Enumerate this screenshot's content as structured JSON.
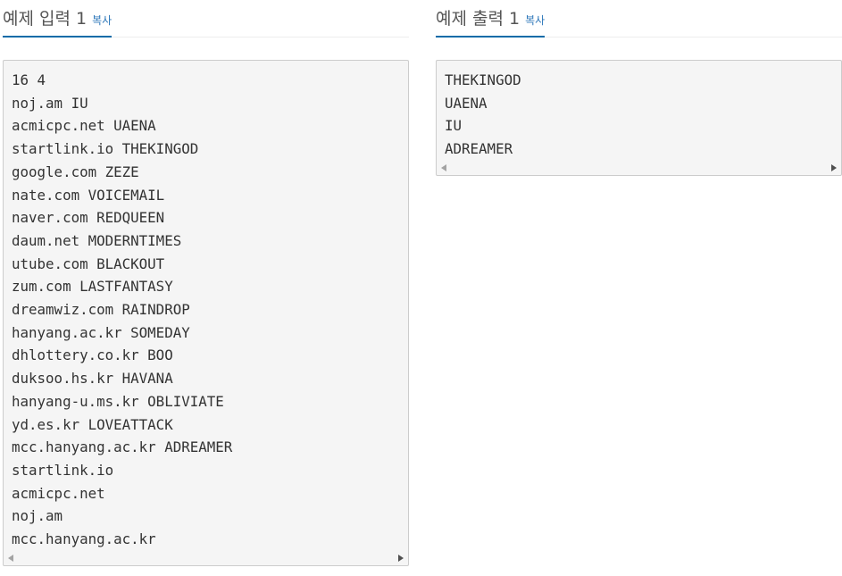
{
  "sample_input": {
    "title": "예제 입력 1",
    "copy_label": "복사",
    "lines": [
      "16 4",
      "noj.am IU",
      "acmicpc.net UAENA",
      "startlink.io THEKINGOD",
      "google.com ZEZE",
      "nate.com VOICEMAIL",
      "naver.com REDQUEEN",
      "daum.net MODERNTIMES",
      "utube.com BLACKOUT",
      "zum.com LASTFANTASY",
      "dreamwiz.com RAINDROP",
      "hanyang.ac.kr SOMEDAY",
      "dhlottery.co.kr BOO",
      "duksoo.hs.kr HAVANA",
      "hanyang-u.ms.kr OBLIVIATE",
      "yd.es.kr LOVEATTACK",
      "mcc.hanyang.ac.kr ADREAMER",
      "startlink.io",
      "acmicpc.net",
      "noj.am",
      "mcc.hanyang.ac.kr"
    ]
  },
  "sample_output": {
    "title": "예제 출력 1",
    "copy_label": "복사",
    "lines": [
      "THEKINGOD",
      "UAENA",
      "IU",
      "ADREAMER"
    ]
  },
  "icons": {
    "scroll_left": "scroll-left-arrow-icon",
    "scroll_right": "scroll-right-arrow-icon"
  },
  "colors": {
    "accent": "#0c6ba8",
    "link": "#2b76b9",
    "box_background": "#f5f5f5",
    "box_border": "#cccccc"
  }
}
